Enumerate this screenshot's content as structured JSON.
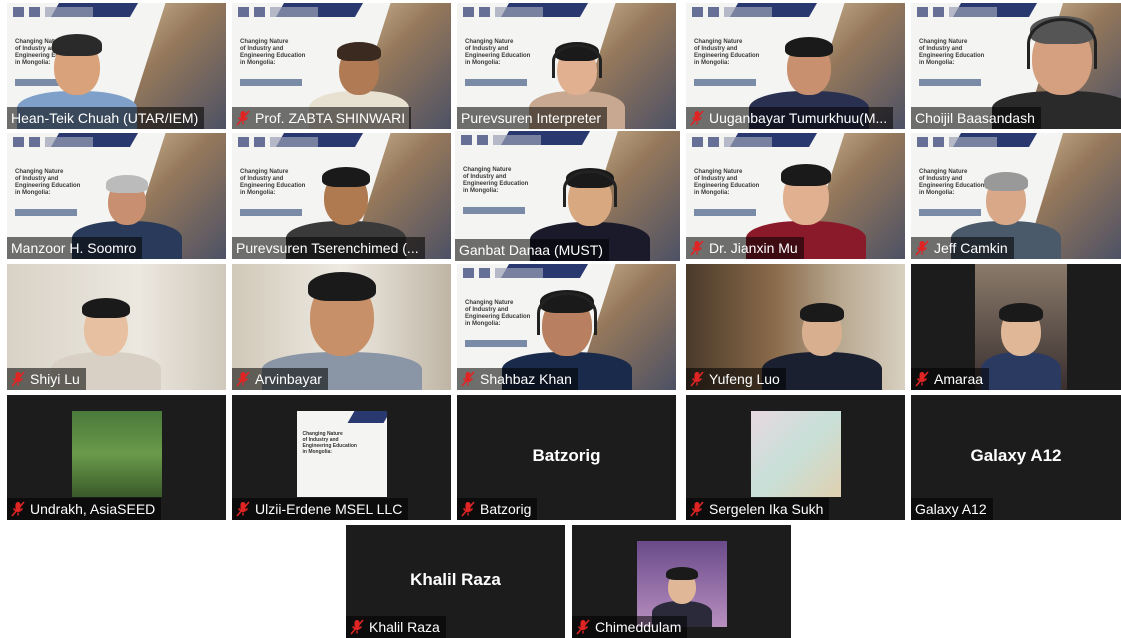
{
  "slide": {
    "lines": [
      "Changing Nature",
      "of Industry and",
      "Engineering Education",
      "in Mongolia:"
    ]
  },
  "participants": [
    {
      "name": "Hean-Teik Chuah (UTAR/IEM)",
      "muted": false
    },
    {
      "name": "Prof. ZABTA SHINWARI",
      "muted": true
    },
    {
      "name": "Purevsuren Interpreter",
      "muted": false
    },
    {
      "name": "Uuganbayar Tumurkhuu(M...",
      "muted": true
    },
    {
      "name": "Choijil Baasandash",
      "muted": false
    },
    {
      "name": "Manzoor H. Soomro",
      "muted": false
    },
    {
      "name": "Purevsuren Tserenchimed (...",
      "muted": false
    },
    {
      "name": "Ganbat Danaa (MUST)",
      "muted": false
    },
    {
      "name": "Dr. Jianxin Mu",
      "muted": true
    },
    {
      "name": "Jeff Camkin",
      "muted": true
    },
    {
      "name": "Shiyi Lu",
      "muted": true
    },
    {
      "name": "Arvinbayar",
      "muted": true
    },
    {
      "name": "Shahbaz Khan",
      "muted": true
    },
    {
      "name": "Yufeng Luo",
      "muted": true
    },
    {
      "name": "Amaraa",
      "muted": true
    },
    {
      "name": "Undrakh, AsiaSEED",
      "muted": true
    },
    {
      "name": "Ulzii-Erdene MSEL LLC",
      "muted": true
    },
    {
      "name": "Batzorig",
      "muted": true,
      "display": "Batzorig"
    },
    {
      "name": "Sergelen Ika Sukh",
      "muted": true
    },
    {
      "name": "Galaxy A12",
      "muted": false,
      "display": "Galaxy A12"
    },
    {
      "name": "Khalil Raza",
      "muted": true,
      "display": "Khalil Raza"
    },
    {
      "name": "Chimeddulam",
      "muted": true
    }
  ],
  "colors": {
    "active_border": "#c8d51e",
    "tile_bg": "#1c1c1c",
    "muted_icon": "#e02424"
  }
}
